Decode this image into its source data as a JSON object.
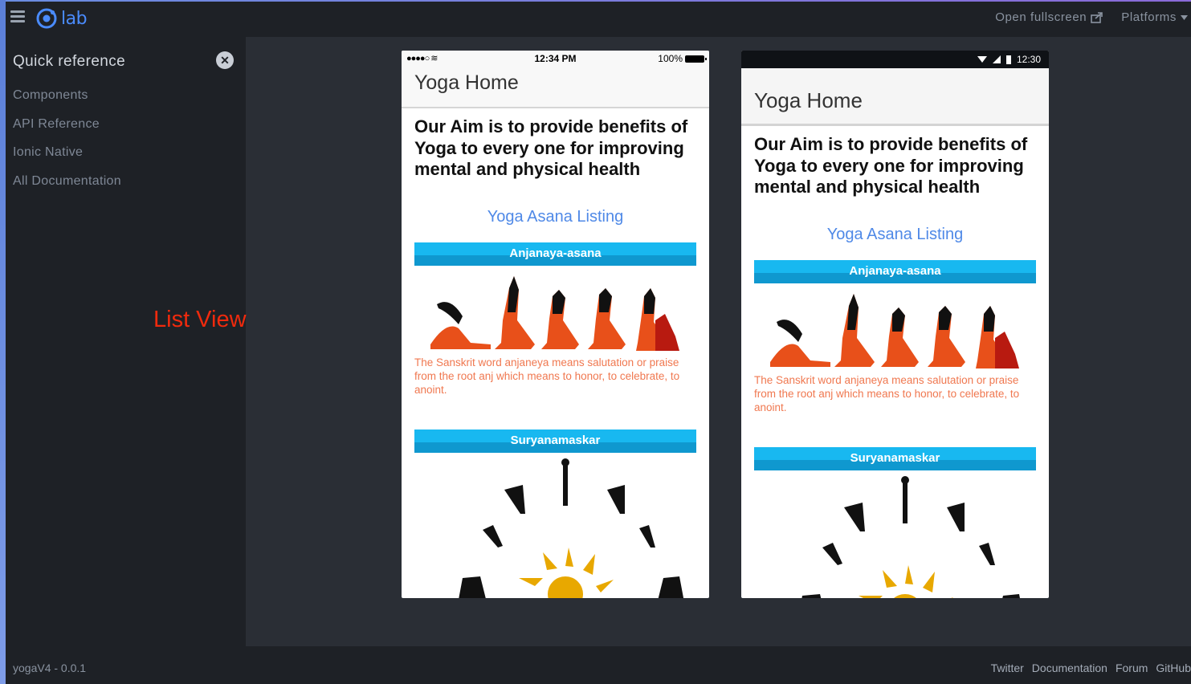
{
  "header": {
    "logo_text": "lab",
    "open_fullscreen": "Open fullscreen",
    "platforms": "Platforms"
  },
  "sidebar": {
    "title": "Quick reference",
    "items": [
      {
        "label": "Components"
      },
      {
        "label": "API Reference"
      },
      {
        "label": "Ionic Native"
      },
      {
        "label": "All Documentation"
      }
    ]
  },
  "annotation": "List View",
  "footer": {
    "version": "yogaV4 - 0.0.1",
    "links": [
      "Twitter",
      "Documentation",
      "Forum",
      "GitHub"
    ]
  },
  "ios": {
    "status_time": "12:34 PM",
    "battery": "100%",
    "title": "Yoga Home"
  },
  "android": {
    "status_time": "12:30",
    "title": "Yoga Home"
  },
  "app": {
    "aim": "Our Aim is to provide benefits of Yoga to every one for improving mental and physical health",
    "listing_title": "Yoga Asana Listing",
    "asanas": [
      {
        "name": "Anjanaya-asana",
        "description": "The Sanskrit word anjaneya means salutation or praise from the root anj which means to honor, to celebrate, to anoint."
      },
      {
        "name": "Suryanamaskar"
      }
    ]
  },
  "colors": {
    "accent": "#4a8bfc",
    "annotation": "#f02a0d",
    "asana_bar": "#18b8f0",
    "description": "#f07850"
  }
}
